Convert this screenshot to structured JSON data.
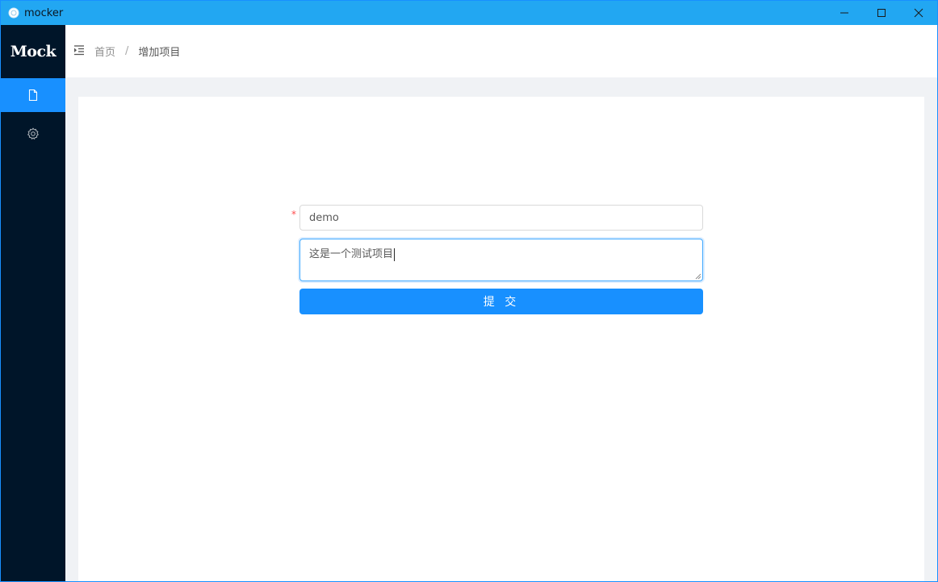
{
  "window": {
    "title": "mocker",
    "icon": "app-icon",
    "controls": [
      "minimize-icon",
      "maximize-icon",
      "close-icon"
    ]
  },
  "sidebar": {
    "logo": "Mock",
    "items": [
      {
        "icon": "file-icon",
        "active": true
      },
      {
        "icon": "gear-icon",
        "active": false
      }
    ]
  },
  "header": {
    "toggle_icon": "menu-fold-icon",
    "breadcrumb": {
      "home": "首页",
      "separator": "/",
      "current": "增加项目"
    }
  },
  "form": {
    "name_value": "demo",
    "description_value": "这是一个测试项目",
    "submit_label": "提 交"
  },
  "colors": {
    "titlebar": "#22a7f2",
    "sidebar": "#001529",
    "accent": "#1890ff",
    "background": "#f0f2f5",
    "required": "#ff4d4f"
  }
}
